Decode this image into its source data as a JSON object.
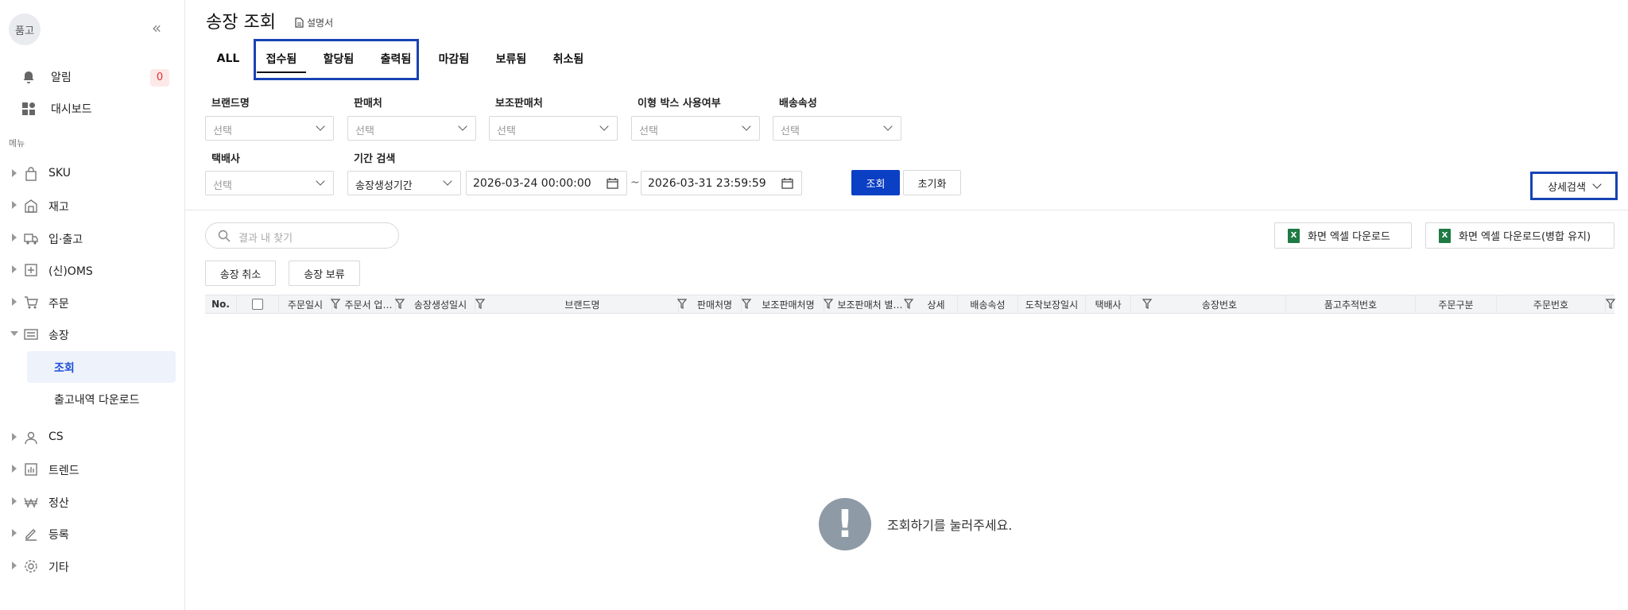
{
  "sidebar": {
    "logo": "품고",
    "collapse_icon": "double-chevron-left",
    "alert": {
      "label": "알림",
      "count": "0"
    },
    "dashboard": "대시보드",
    "menu_caption": "메뉴",
    "nav": [
      {
        "label": "SKU",
        "icon": "bag-icon",
        "expanded": false
      },
      {
        "label": "재고",
        "icon": "warehouse-icon",
        "expanded": false
      },
      {
        "label": "입·출고",
        "icon": "truck-icon",
        "expanded": false
      },
      {
        "label": "(신)OMS",
        "icon": "oms-icon",
        "expanded": false
      },
      {
        "label": "주문",
        "icon": "cart-icon",
        "expanded": false
      },
      {
        "label": "송장",
        "icon": "invoice-icon",
        "expanded": true
      },
      {
        "label": "CS",
        "icon": "person-icon",
        "expanded": false
      },
      {
        "label": "트렌드",
        "icon": "chart-icon",
        "expanded": false
      },
      {
        "label": "정산",
        "icon": "won-icon",
        "expanded": false
      },
      {
        "label": "등록",
        "icon": "pencil-icon",
        "expanded": false
      },
      {
        "label": "기타",
        "icon": "gear-icon",
        "expanded": false
      }
    ],
    "invoice_sub": {
      "lookup": "조회",
      "download": "출고내역 다운로드"
    }
  },
  "header": {
    "title": "송장 조회",
    "manual": "설명서"
  },
  "tabs": [
    "ALL",
    "접수됨",
    "할당됨",
    "출력됨",
    "마감됨",
    "보류됨",
    "취소됨"
  ],
  "filters": {
    "brand": {
      "label": "브랜드명",
      "value": "선택"
    },
    "seller": {
      "label": "판매처",
      "value": "선택"
    },
    "sub_seller": {
      "label": "보조판매처",
      "value": "선택"
    },
    "odd_box": {
      "label": "이형 박스 사용여부",
      "value": "선택"
    },
    "shipping_attr": {
      "label": "배송속성",
      "value": "선택"
    },
    "courier": {
      "label": "택배사",
      "value": "선택"
    },
    "period": {
      "label": "기간 검색",
      "type": "송장생성기간",
      "from": "2026-03-24 00:00:00",
      "tilde": "~",
      "to": "2026-03-31 23:59:59"
    },
    "search_button": "조회",
    "reset_button": "초기화",
    "detail_button": "상세검색"
  },
  "toolbar": {
    "search_placeholder": "결과 내 찾기",
    "excel_download": "화면 엑셀 다운로드",
    "excel_download_merge": "화면 엑셀 다운로드(병합 유지)",
    "cancel_invoice": "송장 취소",
    "hold_invoice": "송장 보류"
  },
  "table": {
    "columns": [
      "No.",
      "",
      "주문일시",
      "주문서 업…",
      "송장생성일시",
      "브랜드명",
      "판매처명",
      "보조판매처명",
      "보조판매처 별…",
      "상세",
      "배송속성",
      "도착보장일시",
      "택배사",
      "송장번호",
      "품고추적번호",
      "주문구분",
      "주문번호"
    ]
  },
  "empty_state": {
    "message": "조회하기를 눌러주세요."
  },
  "colors": {
    "primary": "#0b3fc4",
    "highlight_box": "#1743b3",
    "badge": "#e03131"
  }
}
